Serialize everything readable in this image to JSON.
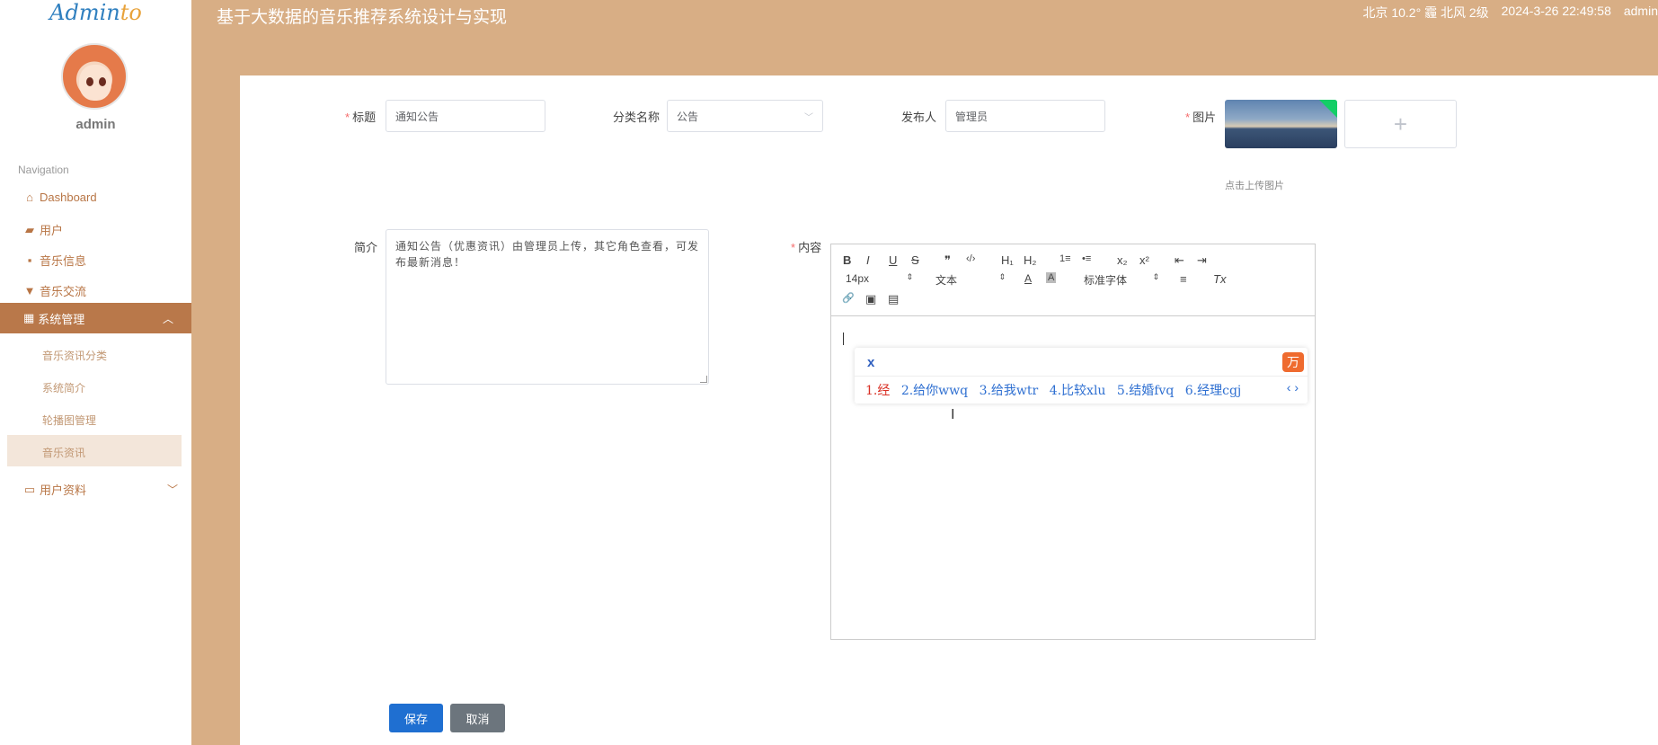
{
  "app": {
    "logo_part1": "Admin",
    "logo_part2": "to",
    "username": "admin"
  },
  "header": {
    "title": "基于大数据的音乐推荐系统设计与实现",
    "weather": "北京  10.2°  霾  北风  2级",
    "datetime": "2024-3-26 22:49:58",
    "user": "admin"
  },
  "sidebar": {
    "nav_title": "Navigation",
    "items": [
      {
        "label": "Dashboard",
        "icon": "home-icon"
      },
      {
        "label": "用户",
        "icon": "ticket-icon"
      },
      {
        "label": "音乐信息",
        "icon": "camera-icon"
      },
      {
        "label": "音乐交流",
        "icon": "cup-icon"
      },
      {
        "label": "系统管理",
        "icon": "grid-icon"
      },
      {
        "label": "用户资料",
        "icon": "card-icon"
      }
    ],
    "sub_items": [
      "音乐资讯分类",
      "系统简介",
      "轮播图管理",
      "音乐资讯"
    ]
  },
  "form": {
    "title_label": "标题",
    "title_value": "通知公告",
    "category_label": "分类名称",
    "category_value": "公告",
    "publisher_label": "发布人",
    "publisher_value": "管理员",
    "image_label": "图片",
    "upload_plus": "+",
    "upload_hint": "点击上传图片",
    "summary_label": "简介",
    "summary_value": "通知公告（优惠资讯）由管理员上传，其它角色查看，可发布最新消息！",
    "content_label": "内容",
    "save_label": "保存",
    "cancel_label": "取消"
  },
  "editor": {
    "font_size": "14px",
    "paragraph": "文本",
    "font_family": "标准字体",
    "tools": {
      "bold": "B",
      "italic": "I",
      "underline": "U",
      "strike": "S",
      "quote": "❞",
      "code": "‹/›",
      "h1": "H₁",
      "h2": "H₂",
      "ol": "1≡",
      "ul": "•≡",
      "sub": "x₂",
      "sup": "x²",
      "outdent": "⇤",
      "indent": "⇥",
      "color": "A",
      "bg": "A",
      "align": "≡",
      "clean": "Tx",
      "link": "🔗",
      "image": "▣",
      "video": "▤"
    }
  },
  "ime": {
    "input": "x",
    "candidates": [
      "1.经",
      "2.给你wwq",
      "3.给我wtr",
      "4.比较xlu",
      "5.结婚fvq",
      "6.经理cgj"
    ],
    "nav": "‹ ›",
    "logo": "万"
  }
}
